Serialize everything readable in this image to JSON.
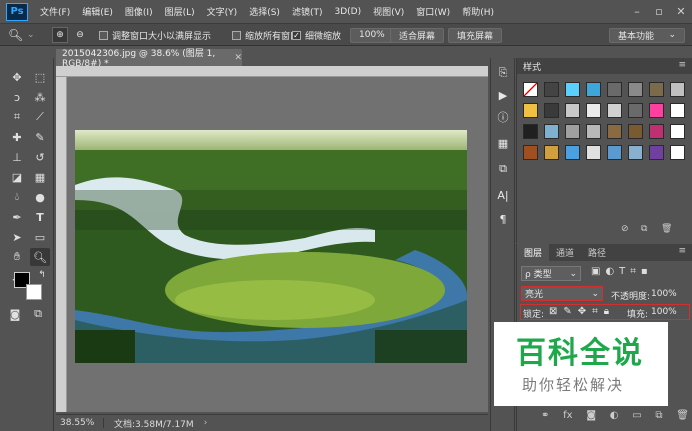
{
  "app": {
    "logo": "Ps"
  },
  "menu": [
    "文件(F)",
    "编辑(E)",
    "图像(I)",
    "图层(L)",
    "文字(Y)",
    "选择(S)",
    "滤镜(T)",
    "3D(D)",
    "视图(V)",
    "窗口(W)",
    "帮助(H)"
  ],
  "options": {
    "resize_windows": "调整窗口大小以满屏显示",
    "zoom_all": "缩放所有窗口",
    "scrubby_zoom": "细微缩放",
    "zoom_value": "100%",
    "fit_screen": "适合屏幕",
    "fill_screen": "填充屏幕",
    "workspace": "基本功能"
  },
  "document": {
    "tab_title": "2015042306.jpg @ 38.6% (图层 1, RGB/8#) *",
    "zoom": "38.55%",
    "doc_info": "文档:3.58M/7.17M"
  },
  "styles_panel": {
    "title": "样式"
  },
  "layers_panel": {
    "tabs": [
      "图层",
      "通道",
      "路径"
    ],
    "filter": "ρ 类型",
    "blend_mode": "亮光",
    "opacity_label": "不透明度:",
    "opacity": "100%",
    "lock_label": "锁定:",
    "fill_label": "填充:",
    "fill": "100%"
  },
  "watermark": {
    "title": "百科全说",
    "subtitle": "助你轻松解决"
  },
  "colors": {
    "ui_bg": "#535353",
    "panel_header": "#424242",
    "accent": "#31a8ff",
    "watermark_title": "#1fa84b"
  }
}
